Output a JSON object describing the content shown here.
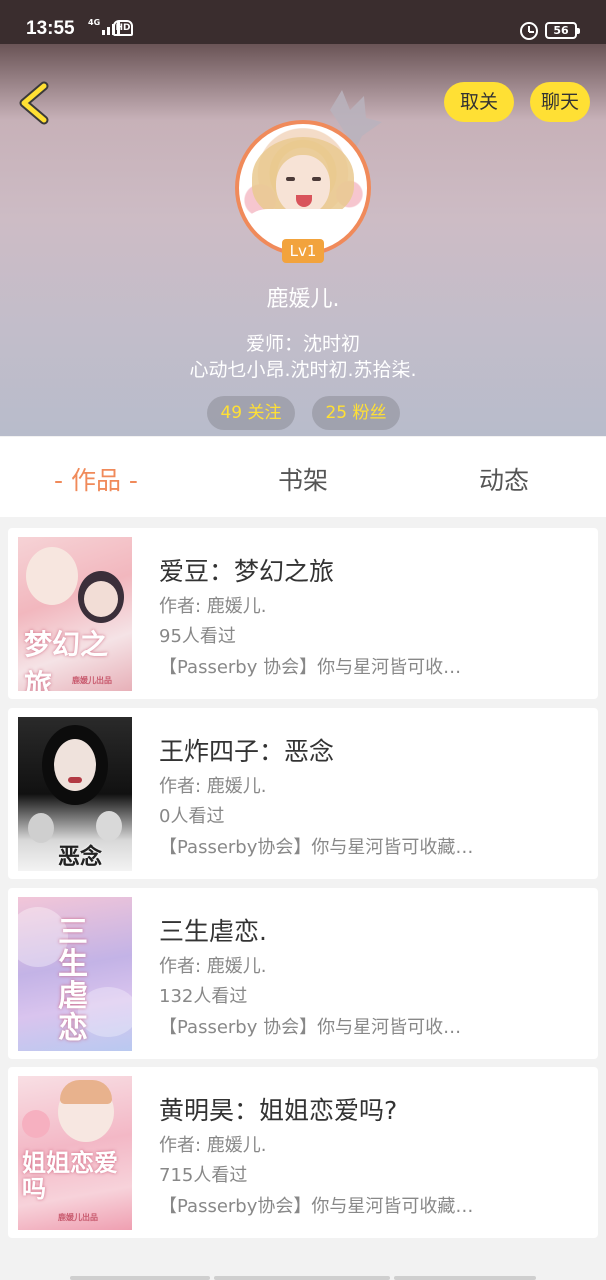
{
  "status_bar": {
    "time": "13:55",
    "network": "4G",
    "hd": "HD",
    "battery": "56"
  },
  "header": {
    "unfollow_label": "取关",
    "chat_label": "聊天",
    "level": "Lv1",
    "username": "鹿媛儿.",
    "bio_line1": "爱师：沈时初",
    "bio_line2": "心动乜小昂.沈时初.苏拾柒.",
    "following": "49 关注",
    "fans": "25 粉丝",
    "accent_color": "#ffe034"
  },
  "tabs": [
    {
      "label": "- 作品 -",
      "active": true
    },
    {
      "label": "书架",
      "active": false
    },
    {
      "label": "动态",
      "active": false
    }
  ],
  "books": [
    {
      "title": "爱豆：梦幻之旅",
      "author": "作者: 鹿媛儿.",
      "views": "95人看过",
      "tag": "【Passerby 协会】你与星河皆可收…",
      "cover_text": "梦幻之旅",
      "cover_sub": "鹿媛儿出品"
    },
    {
      "title": "王炸四子：恶念",
      "author": "作者: 鹿媛儿.",
      "views": "0人看过",
      "tag": "【Passerby协会】你与星河皆可收藏…",
      "cover_text": "恶念",
      "cover_sub": ""
    },
    {
      "title": "三生虐恋.",
      "author": "作者: 鹿媛儿.",
      "views": "132人看过",
      "tag": "【Passerby 协会】你与星河皆可收…",
      "cover_text": "三生虐恋",
      "cover_sub": ""
    },
    {
      "title": "黄明昊：姐姐恋爱吗?",
      "author": "作者: 鹿媛儿.",
      "views": "715人看过",
      "tag": "【Passerby协会】你与星河皆可收藏…",
      "cover_text": "姐姐恋爱吗",
      "cover_sub": "鹿媛儿出品"
    }
  ]
}
